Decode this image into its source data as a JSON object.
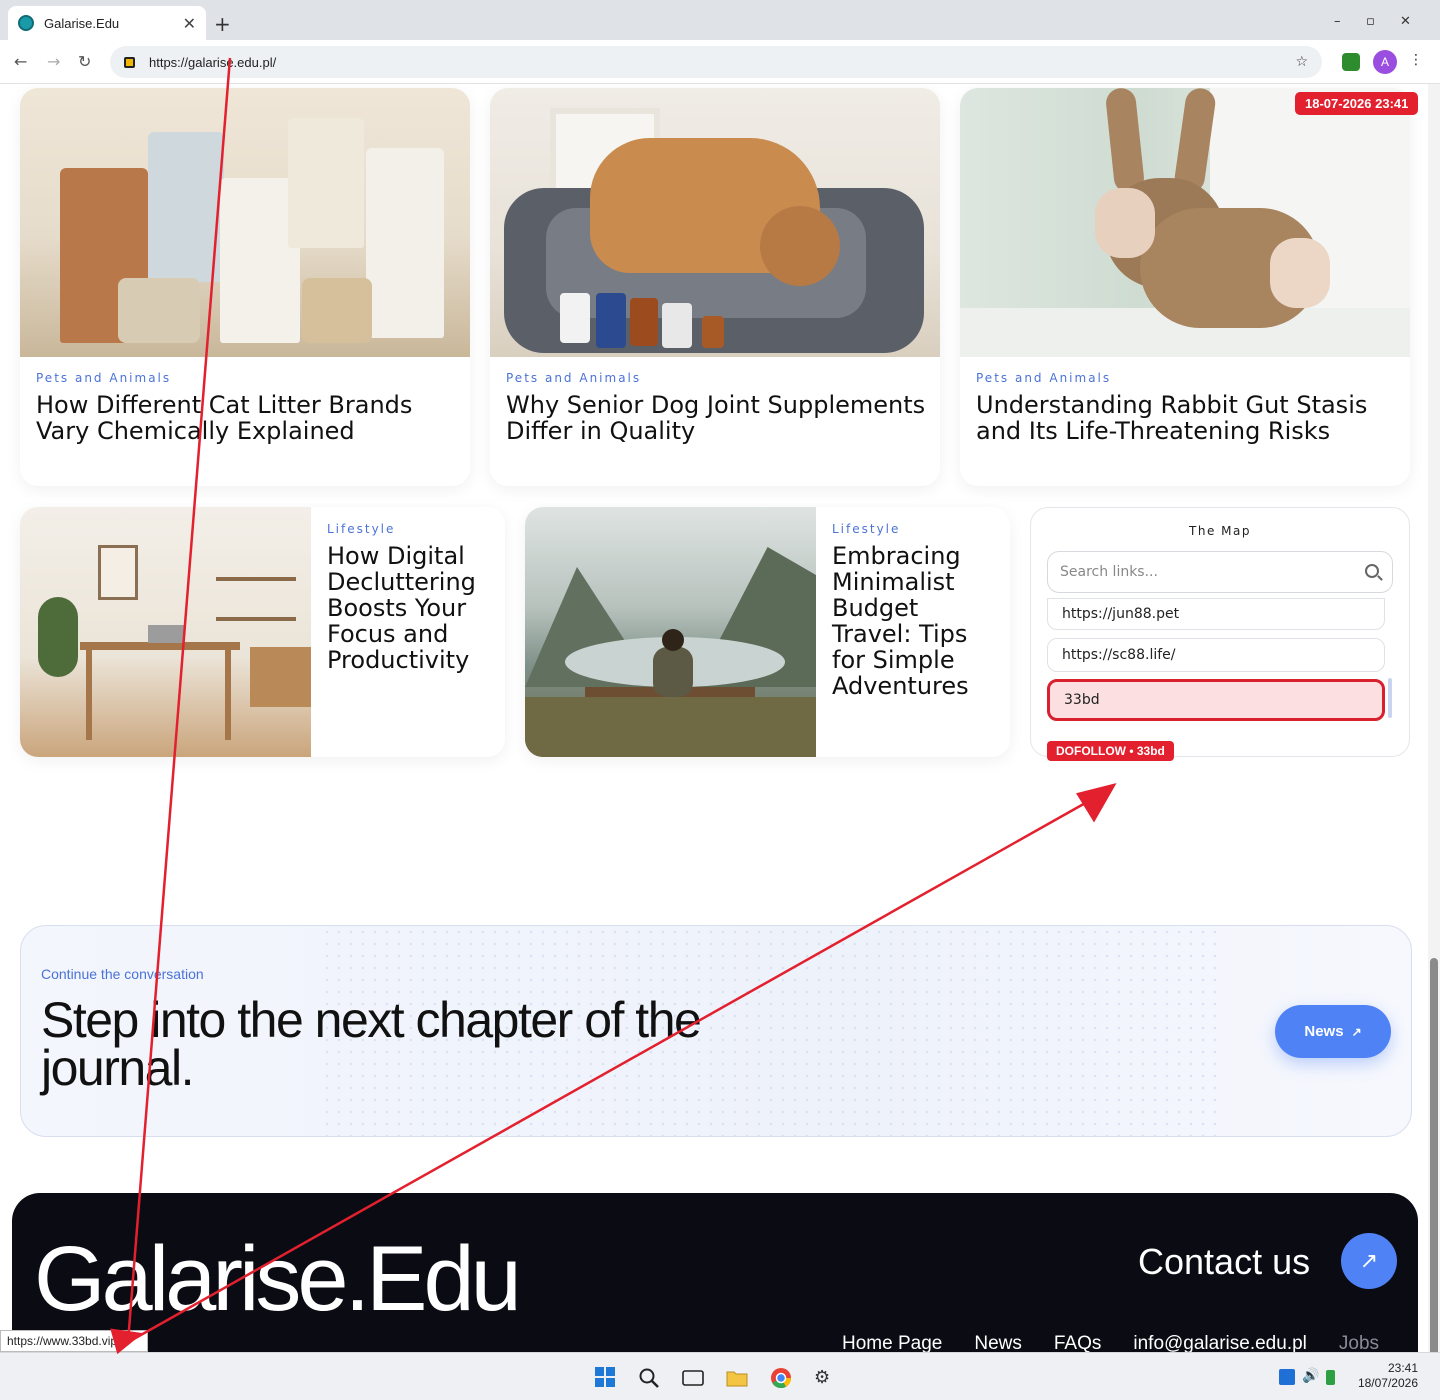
{
  "browser": {
    "tab_title": "Galarise.Edu",
    "new_tab": "+",
    "url": "https://galarise.edu.pl/",
    "profile_initial": "A",
    "window_controls": {
      "minimize": "–",
      "maximize": "▫",
      "close": "✕"
    },
    "nav": {
      "back": "←",
      "forward": "→",
      "reload": "↻"
    }
  },
  "timestamp_badge": "18-07-2026 23:41",
  "articles_top": [
    {
      "category": "Pets and Animals",
      "title": "How Different Cat Litter Brands Vary Chemically Explained"
    },
    {
      "category": "Pets and Animals",
      "title": "Why Senior Dog Joint Supplements Differ in Quality"
    },
    {
      "category": "Pets and Animals",
      "title": "Understanding Rabbit Gut Stasis and Its Life-Threatening Risks"
    }
  ],
  "articles_bottom": [
    {
      "category": "Lifestyle",
      "title": "How Digital Decluttering Boosts Your Focus and Productivity"
    },
    {
      "category": "Lifestyle",
      "title": "Embracing Minimalist Budget Travel: Tips for Simple Adventures"
    }
  ],
  "map_widget": {
    "title": "The Map",
    "search_placeholder": "Search links...",
    "links": [
      "https://jun88.pet",
      "https://sc88.life/",
      "33bd"
    ]
  },
  "dofollow_badge": "DOFOLLOW • 33bd",
  "cta": {
    "eyebrow": "Continue the conversation",
    "headline": "Step into the next chapter of the journal.",
    "button_label": "News",
    "button_icon": "↗"
  },
  "footer": {
    "brand": "Galarise.Edu",
    "contact": "Contact us",
    "contact_icon": "↗",
    "links": [
      "Home Page",
      "News",
      "FAQs",
      "info@galarise.edu.pl",
      "Jobs"
    ]
  },
  "status_url": "https://www.33bd.vip",
  "taskbar": {
    "time": "23:41",
    "date": "18/07/2026"
  },
  "colors": {
    "accent": "#4f82f5",
    "annotation_red": "#e3202e",
    "category_blue": "#4a72d8",
    "footer_bg": "#0b0b14"
  }
}
